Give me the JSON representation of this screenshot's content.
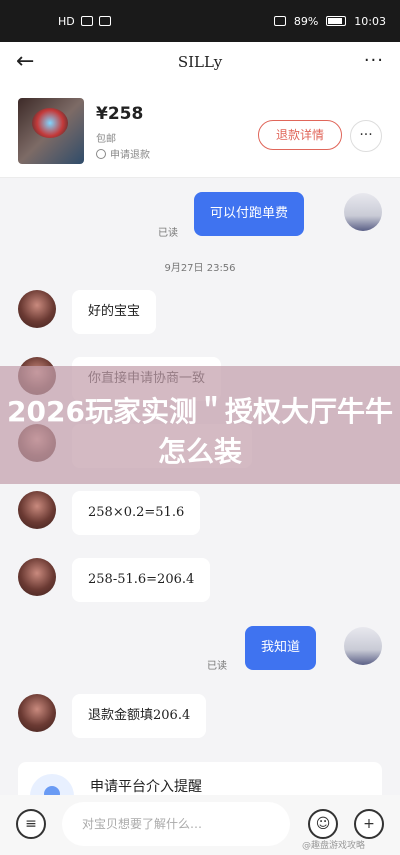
{
  "status_bar": {
    "left_text": "HD",
    "battery_percent": "89%",
    "time": "10:03"
  },
  "header": {
    "back_icon": "arrow-left-icon",
    "title": "SILLy",
    "more_icon": "more-icon"
  },
  "order": {
    "price": "¥258",
    "shipping": "包邮",
    "refund_status": "申请退款",
    "detail_button": "退款详情",
    "menu_button": "···"
  },
  "messages": [
    {
      "side": "out",
      "text": "可以付跑单费",
      "read": "已读"
    },
    {
      "side": "time",
      "text": "9月27日 23:56"
    },
    {
      "side": "in",
      "text": "好的宝宝"
    },
    {
      "side": "in",
      "text": "你直接申请协商一致"
    },
    {
      "side": "in",
      "text": ""
    },
    {
      "side": "in",
      "text": "258×0.2=51.6"
    },
    {
      "side": "in",
      "text": "258-51.6=206.4"
    },
    {
      "side": "out",
      "text": "我知道",
      "read": "已读"
    },
    {
      "side": "in",
      "text": "退款金额填206.4"
    }
  ],
  "banner": {
    "text": "2026玩家实测＂授权大厅牛牛怎么装"
  },
  "card": {
    "title": "申请平台介入提醒"
  },
  "input_bar": {
    "placeholder": "对宝贝想要了解什么…",
    "menu_icon": "menu-icon",
    "emoji_icon": "emoji-icon",
    "plus_icon": "plus-icon"
  },
  "watermark": "@趣盘游戏攻略"
}
